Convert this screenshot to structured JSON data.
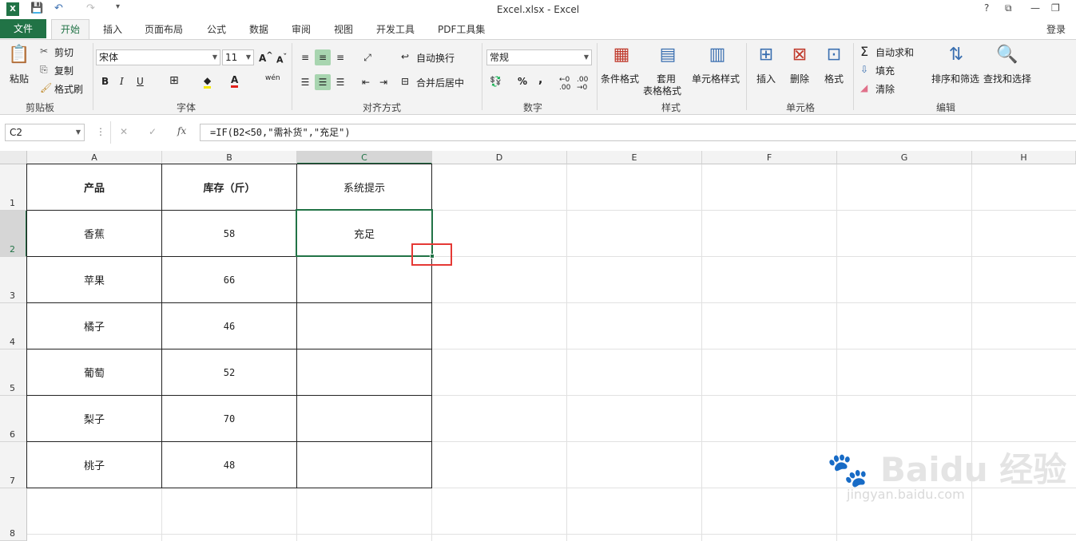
{
  "window": {
    "title": "Excel.xlsx - Excel",
    "help": "?",
    "signin": "登录",
    "min": "—",
    "restore": "❐"
  },
  "tabs": [
    "文件",
    "开始",
    "插入",
    "页面布局",
    "公式",
    "数据",
    "审阅",
    "视图",
    "开发工具",
    "PDF工具集"
  ],
  "ribbon": {
    "clipboard": {
      "paste": "粘贴",
      "cut": "剪切",
      "copy": "复制",
      "format_painter": "格式刷",
      "group": "剪贴板"
    },
    "font": {
      "name": "宋体",
      "size": "11",
      "group": "字体",
      "wen": "wén"
    },
    "align": {
      "wrap": "自动换行",
      "merge": "合并后居中",
      "group": "对齐方式"
    },
    "number": {
      "format": "常规",
      "group": "数字",
      "pct": "%",
      "comma": ","
    },
    "styles": {
      "cond": "条件格式",
      "table1": "套用",
      "table2": "表格格式",
      "cell": "单元格样式",
      "group": "样式"
    },
    "cells": {
      "insert": "插入",
      "delete": "删除",
      "format": "格式",
      "group": "单元格"
    },
    "edit": {
      "autosum": "自动求和",
      "fill": "填充",
      "clear": "清除",
      "sort": "排序和筛选",
      "find": "查找和选择",
      "group": "编辑"
    }
  },
  "formula_bar": {
    "name_box": "C2",
    "cancel": "✕",
    "enter": "✓",
    "fx": "fx",
    "formula": "=IF(B2<50,\"需补货\",\"充足\")"
  },
  "columns": [
    "A",
    "B",
    "C",
    "D",
    "E",
    "F",
    "G",
    "H"
  ],
  "rows": [
    "1",
    "2",
    "3",
    "4",
    "5",
    "6",
    "7",
    "8"
  ],
  "sheet": {
    "headers": [
      "产品",
      "库存（斤）",
      "系统提示"
    ],
    "data": [
      [
        "香蕉",
        "58",
        "充足"
      ],
      [
        "苹果",
        "66",
        ""
      ],
      [
        "橘子",
        "46",
        ""
      ],
      [
        "葡萄",
        "52",
        ""
      ],
      [
        "梨子",
        "70",
        ""
      ],
      [
        "桃子",
        "48",
        ""
      ]
    ]
  },
  "watermark": {
    "logo": "Bai du 经验",
    "url": "jingyan.baidu.com"
  },
  "colors": {
    "accent": "#217346",
    "highlight": "#e53935"
  }
}
